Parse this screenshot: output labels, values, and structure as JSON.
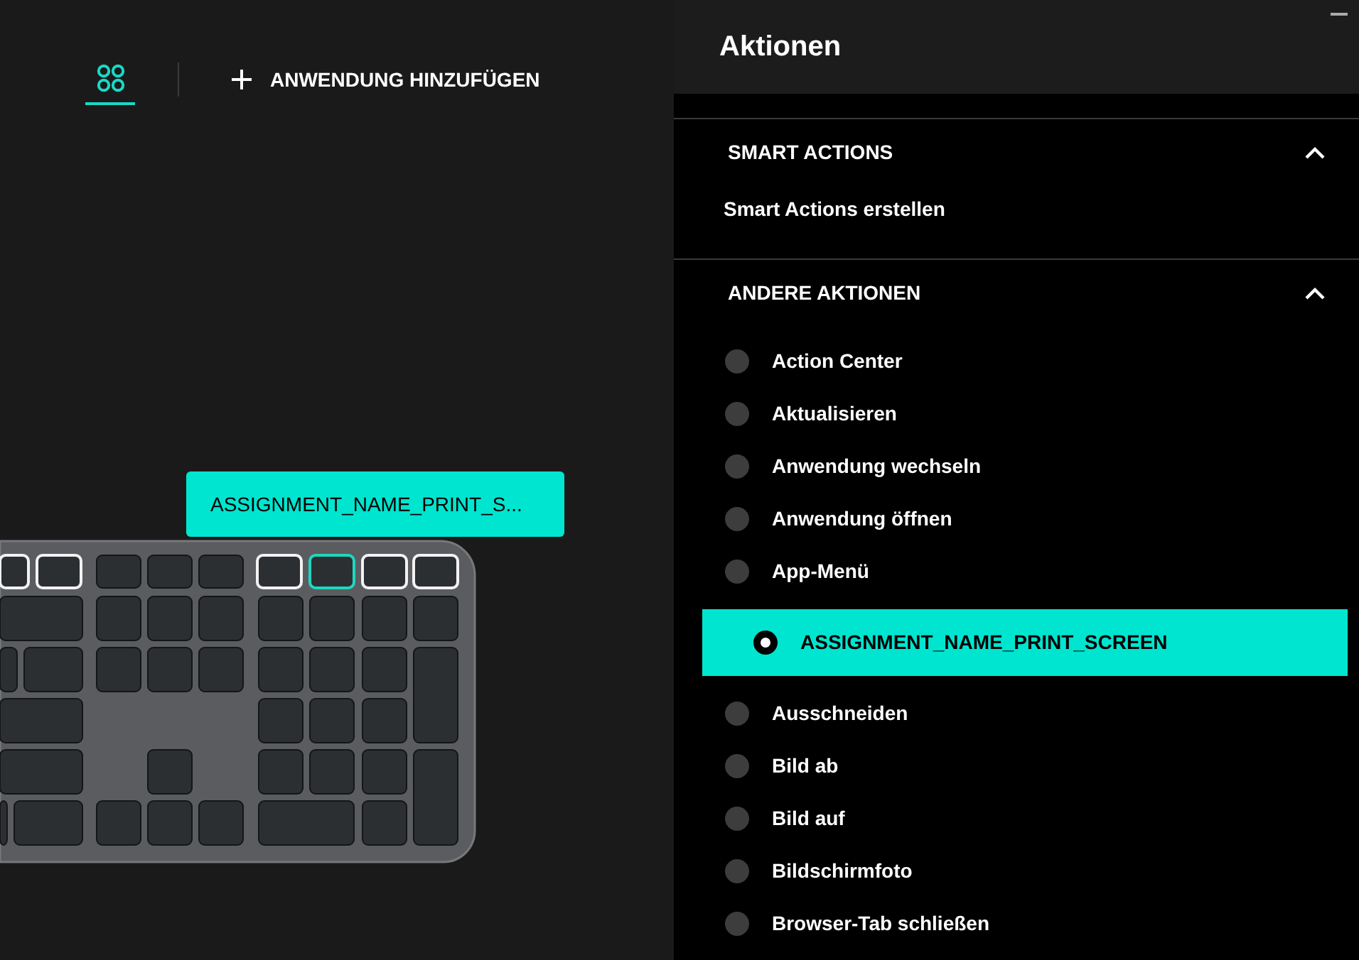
{
  "toolbar": {
    "apps_tab": {
      "selected": true
    },
    "add_button": {
      "label": "ANWENDUNG HINZUFÜGEN"
    }
  },
  "tooltip": {
    "text": "ASSIGNMENT_NAME_PRINT_S..."
  },
  "panel": {
    "title": "Aktionen",
    "sections": [
      {
        "title": "SMART ACTIONS",
        "expanded": true,
        "kind": "links",
        "items": [
          {
            "label": "Smart Actions erstellen"
          }
        ]
      },
      {
        "title": "ANDERE AKTIONEN",
        "expanded": true,
        "kind": "radios",
        "items": [
          {
            "label": "Action Center",
            "selected": false
          },
          {
            "label": "Aktualisieren",
            "selected": false
          },
          {
            "label": "Anwendung wechseln",
            "selected": false
          },
          {
            "label": "Anwendung öffnen",
            "selected": false
          },
          {
            "label": "App-Menü",
            "selected": false
          },
          {
            "label": "ASSIGNMENT_NAME_PRINT_SCREEN",
            "selected": true
          },
          {
            "label": "Ausschneiden",
            "selected": false
          },
          {
            "label": "Bild ab",
            "selected": false
          },
          {
            "label": "Bild auf",
            "selected": false
          },
          {
            "label": "Bildschirmfoto",
            "selected": false
          },
          {
            "label": "Browser-Tab schließen",
            "selected": false
          }
        ]
      }
    ]
  }
}
